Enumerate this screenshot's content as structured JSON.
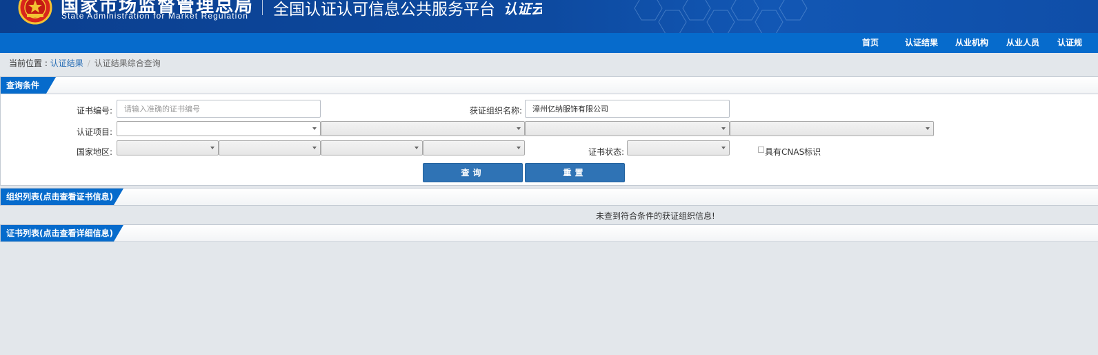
{
  "header": {
    "org_name_cn": "国家市场监督管理总局",
    "org_name_en": "State Administration  for  Market Regulation",
    "platform_title": "全国认证认可信息公共服务平台",
    "platform_logo_text": "认证云"
  },
  "nav": {
    "items": [
      "首页",
      "认证结果",
      "从业机构",
      "从业人员",
      "认证规"
    ]
  },
  "breadcrumb": {
    "prefix": "当前位置 : ",
    "parent": "认证结果",
    "separator": "/",
    "current": "认证结果综合查询"
  },
  "query_panel": {
    "title": "查询条件",
    "cert_no_label": "证书编号:",
    "cert_no_placeholder": "请输入准确的证书编号",
    "cert_no_value": "",
    "org_name_label": "获证组织名称:",
    "org_name_value": "漳州亿纳服饰有限公司",
    "project_label": "认证项目:",
    "region_label": "国家地区:",
    "status_label": "证书状态:",
    "cnas_label": "具有CNAS标识",
    "query_button": "查询",
    "reset_button": "重置"
  },
  "org_list": {
    "title": "组织列表(点击查看证书信息)",
    "empty_message": "未查到符合条件的获证组织信息!"
  },
  "cert_list": {
    "title": "证书列表(点击查看详细信息)"
  },
  "colors": {
    "banner_blue": "#0d4aa0",
    "nav_blue": "#066bcc",
    "button_blue": "#2f73b5",
    "link_blue": "#2a6fb6",
    "page_bg": "#e3e7eb"
  }
}
